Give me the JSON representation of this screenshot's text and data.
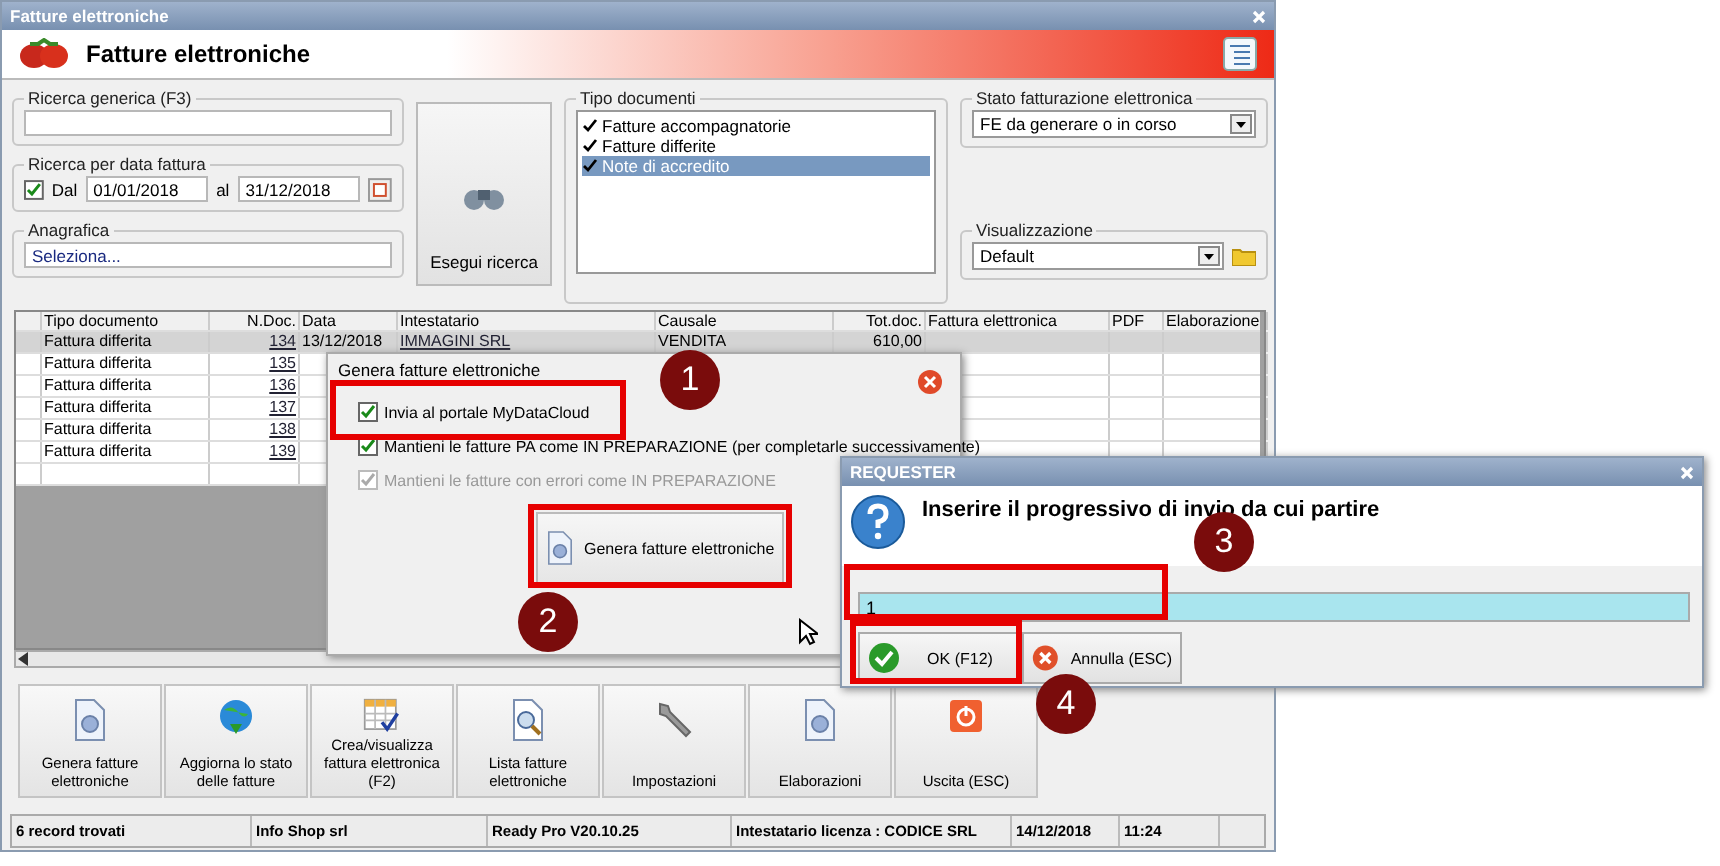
{
  "window": {
    "title": "Fatture elettroniche"
  },
  "header": {
    "title": "Fatture elettroniche"
  },
  "generic_search": {
    "label": "Ricerca generica (F3)"
  },
  "date_search": {
    "label": "Ricerca per data fattura",
    "from_checkbox": {
      "label": "Dal",
      "checked": true
    },
    "from": "01/01/2018",
    "to_label": "al",
    "to": "31/12/2018"
  },
  "anagrafica": {
    "label": "Anagrafica",
    "value": "Seleziona..."
  },
  "search_button": {
    "label": "Esegui ricerca"
  },
  "document_types": {
    "label": "Tipo documenti",
    "items": [
      {
        "label": "Fatture accompagnatorie",
        "checked": true,
        "selected": false
      },
      {
        "label": "Fatture differite",
        "checked": true,
        "selected": false
      },
      {
        "label": "Note di accredito",
        "checked": true,
        "selected": true
      }
    ]
  },
  "status_filter": {
    "label": "Stato fatturazione elettronica",
    "value": "FE da generare o in corso"
  },
  "view": {
    "label": "Visualizzazione",
    "value": "Default"
  },
  "table": {
    "columns": [
      "Tipo documento",
      "N.Doc.",
      "Data",
      "Intestatario",
      "Causale",
      "Tot.doc.",
      "Fattura elettronica",
      "PDF",
      "Elaborazione"
    ],
    "rows": [
      {
        "selected": true,
        "cells": [
          "Fattura differita",
          "134",
          "13/12/2018",
          "IMMAGINI SRL",
          "VENDITA",
          "610,00"
        ]
      },
      {
        "selected": false,
        "cells": [
          "Fattura differita",
          "135"
        ]
      },
      {
        "selected": false,
        "cells": [
          "Fattura differita",
          "136"
        ]
      },
      {
        "selected": false,
        "cells": [
          "Fattura differita",
          "137"
        ]
      },
      {
        "selected": false,
        "cells": [
          "Fattura differita",
          "138"
        ]
      },
      {
        "selected": false,
        "cells": [
          "Fattura differita",
          "139"
        ]
      }
    ]
  },
  "toolbar": [
    {
      "label": "Genera fatture elettroniche",
      "kind": "gear-doc"
    },
    {
      "label": "Aggiorna lo stato delle fatture",
      "kind": "globe"
    },
    {
      "label": "Crea/visualizza fattura elettronica (F2)",
      "kind": "grid"
    },
    {
      "label": "Lista fatture elettroniche",
      "kind": "search-doc"
    },
    {
      "label": "Impostazioni",
      "kind": "wrench"
    },
    {
      "label": "Elaborazioni",
      "kind": "gear-doc"
    },
    {
      "label": "Uscita (ESC)",
      "kind": "power"
    }
  ],
  "status_bar": [
    "6 record trovati",
    "Info Shop srl",
    "Ready Pro V20.10.25",
    "Intestatario licenza : CODICE SRL",
    "14/12/2018",
    "11:24"
  ],
  "generate_dialog": {
    "title": "Genera fatture elettroniche",
    "options": [
      {
        "label": "Invia al portale MyDataCloud",
        "checked": true,
        "disabled": false
      },
      {
        "label": "Mantieni le fatture PA come IN PREPARAZIONE (per completarle successivamente)",
        "checked": true,
        "disabled": false
      },
      {
        "label": "Mantieni le fatture con errori come IN PREPARAZIONE",
        "checked": true,
        "disabled": true
      }
    ],
    "button": "Genera fatture elettroniche"
  },
  "requester": {
    "title": "REQUESTER",
    "message": "Inserire il progressivo di invio da cui partire",
    "value": "1",
    "buttons": [
      {
        "label": "OK (F12)",
        "kind": "ok"
      },
      {
        "label": "Annulla (ESC)",
        "kind": "cancel"
      }
    ]
  },
  "annotations": [
    "1",
    "2",
    "3",
    "4"
  ]
}
